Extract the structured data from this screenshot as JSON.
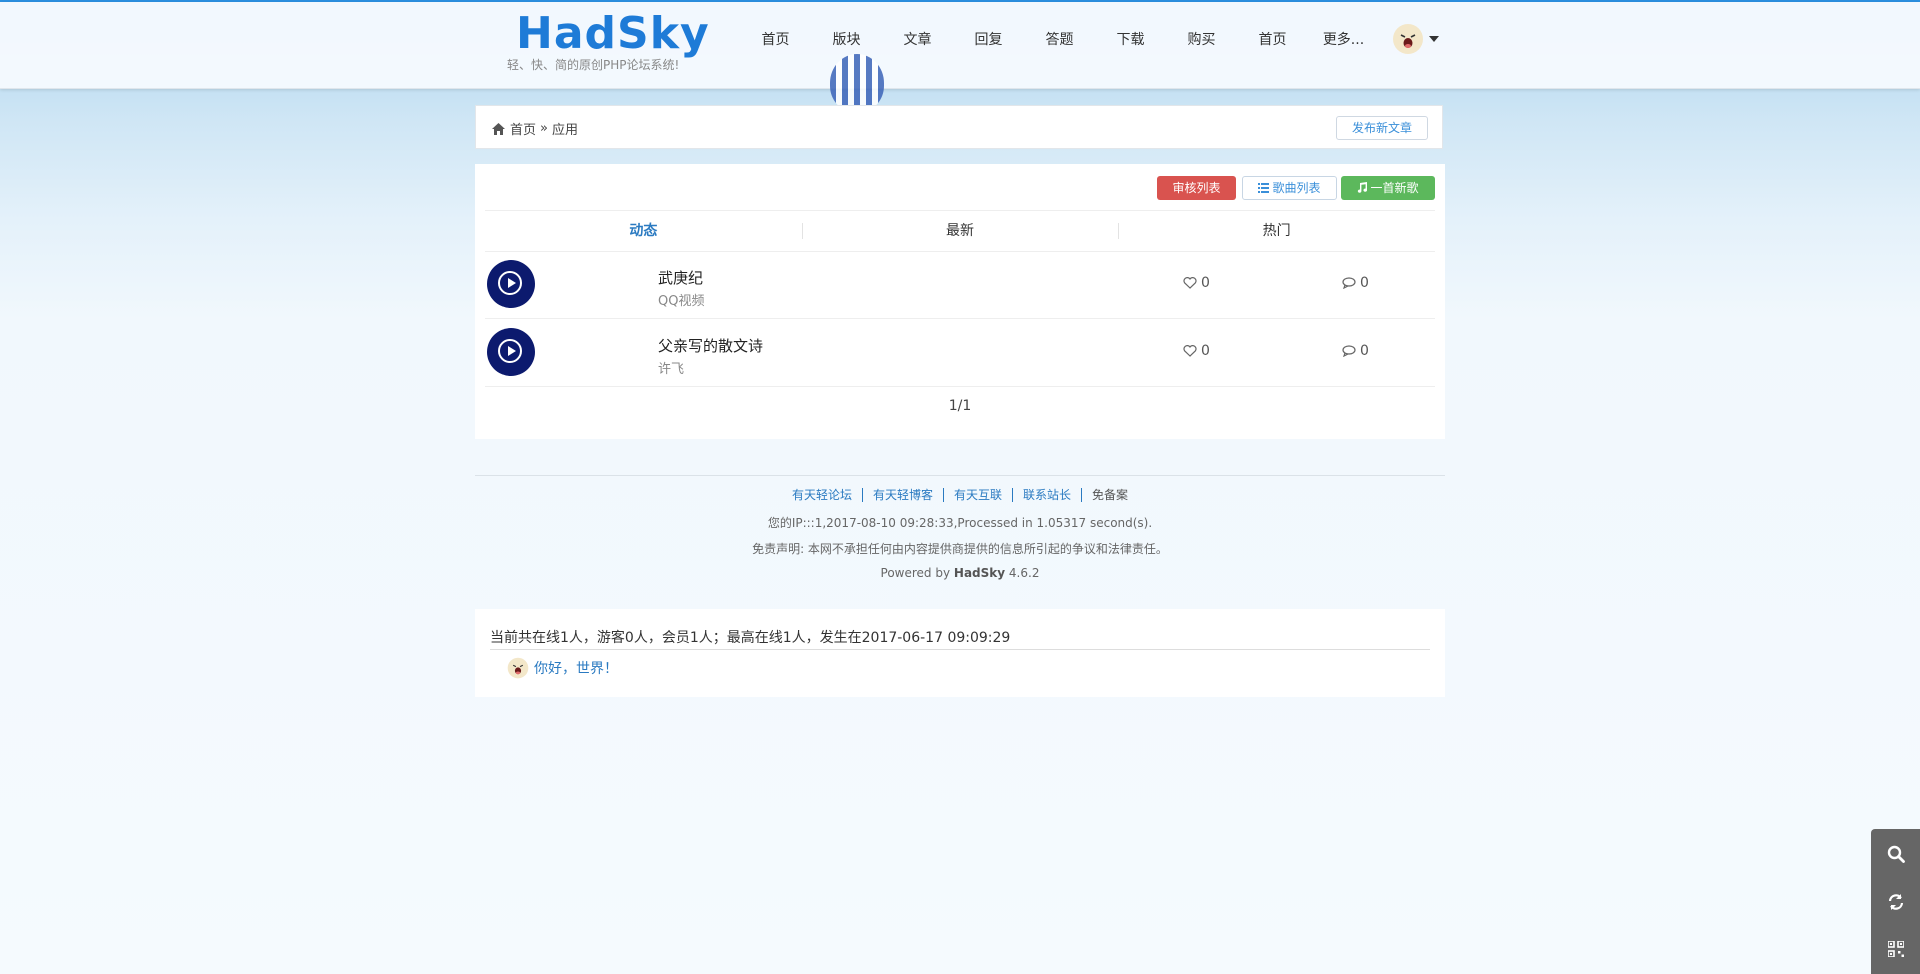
{
  "header": {
    "logo": "HadSky",
    "slogan": "轻、快、简的原创PHP论坛系统!",
    "nav": [
      "首页",
      "版块",
      "文章",
      "回复",
      "答题",
      "下载",
      "购买",
      "首页",
      "更多..."
    ]
  },
  "breadcrumb": {
    "home": "首页",
    "separator": "»",
    "current": "应用",
    "post_button": "发布新文章"
  },
  "toolbar": {
    "review_list": "审核列表",
    "song_list": "歌曲列表",
    "new_song": "一首新歌"
  },
  "tabs": [
    "动态",
    "最新",
    "热门"
  ],
  "songs": [
    {
      "title": "武庚纪",
      "artist": "QQ视频",
      "likes": "0",
      "comments": "0"
    },
    {
      "title": "父亲写的散文诗",
      "artist": "许飞",
      "likes": "0",
      "comments": "0"
    }
  ],
  "pager": "1/1",
  "footer": {
    "links": [
      "有天轻论坛",
      "有天轻博客",
      "有天互联",
      "联系站长"
    ],
    "icp": "免备案",
    "ip_line": "您的IP:::1,2017-08-10 09:28:33,Processed in 1.05317 second(s).",
    "disclaimer": "免责声明: 本网不承担任何由内容提供商提供的信息所引起的争议和法律责任。",
    "powered_prefix": "Powered by",
    "powered_name": "HadSky",
    "powered_version": "4.6.2"
  },
  "online": {
    "summary": "当前共在线1人，游客0人，会员1人；最高在线1人，发生在2017-06-17 09:09:29",
    "user": "你好，世界！"
  },
  "colors": {
    "accent": "#2a7ac1",
    "danger": "#d9534f",
    "success": "#5cb85c",
    "play_button": "#0c1a6e"
  }
}
